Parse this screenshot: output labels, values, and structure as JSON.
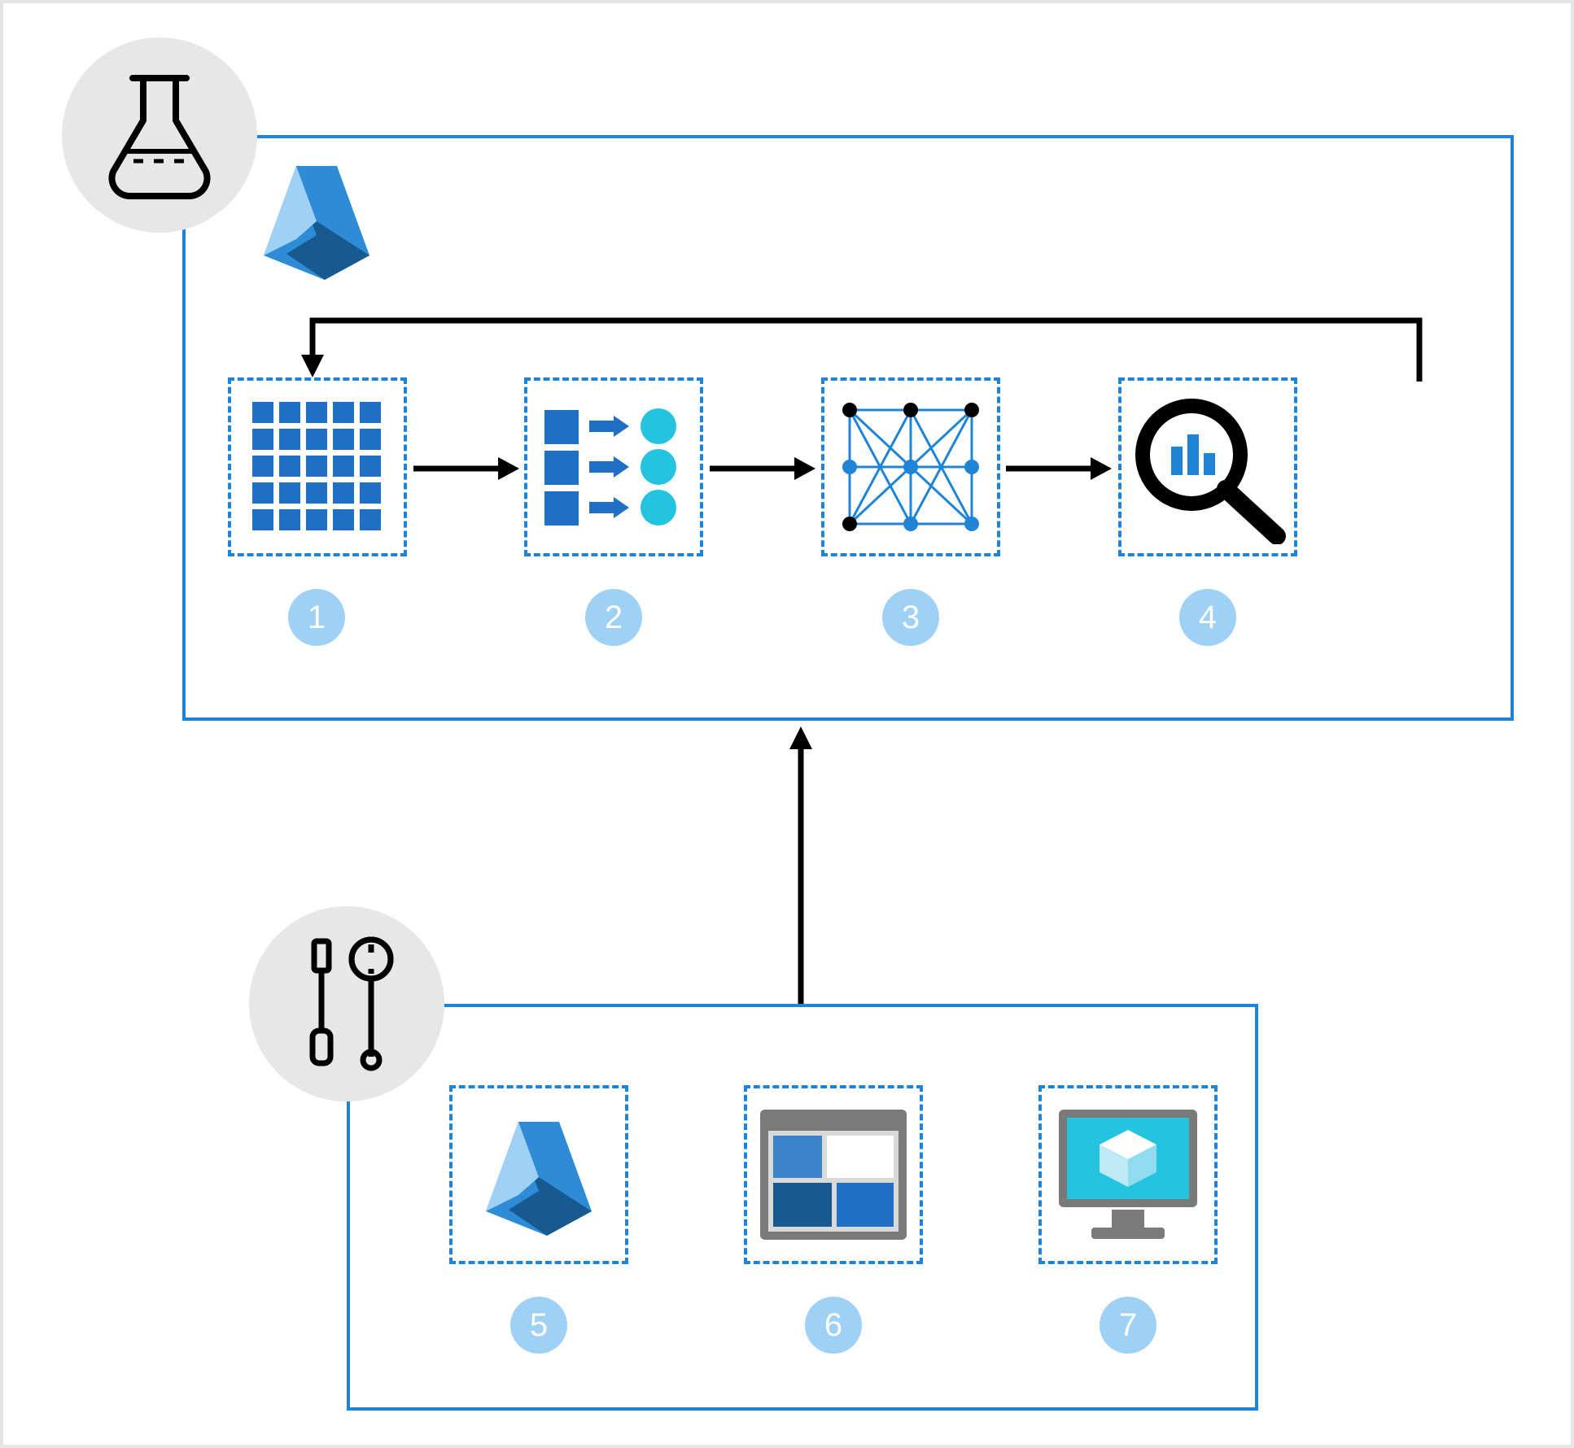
{
  "diagram": {
    "type": "azure-ml-architecture",
    "regions": {
      "experiment": {
        "badge_icon": "flask-icon",
        "header_icon": "azure-ml-icon",
        "steps": [
          {
            "num": "1",
            "icon": "data-grid-icon"
          },
          {
            "num": "2",
            "icon": "data-transform-icon"
          },
          {
            "num": "3",
            "icon": "neural-network-icon"
          },
          {
            "num": "4",
            "icon": "evaluate-magnify-icon"
          }
        ]
      },
      "tools": {
        "badge_icon": "tools-icon",
        "steps": [
          {
            "num": "5",
            "icon": "azure-ml-icon"
          },
          {
            "num": "6",
            "icon": "dashboard-icon"
          },
          {
            "num": "7",
            "icon": "vm-monitor-icon"
          }
        ]
      }
    },
    "flow": [
      "experiment.step1 -> experiment.step2",
      "experiment.step2 -> experiment.step3",
      "experiment.step3 -> experiment.step4",
      "experiment.step4 -> experiment.step1 (loop)",
      "tools -> experiment (supports)"
    ],
    "colors": {
      "outline": "#1f84d6",
      "badge_bg": "#e7e7e7",
      "number_bg": "#9fd0f5",
      "number_fg": "#ffffff",
      "azure_dark": "#175a90",
      "azure_mid": "#2e8bd6",
      "cyan": "#24c4e0",
      "grey": "#7a7a7a"
    }
  }
}
